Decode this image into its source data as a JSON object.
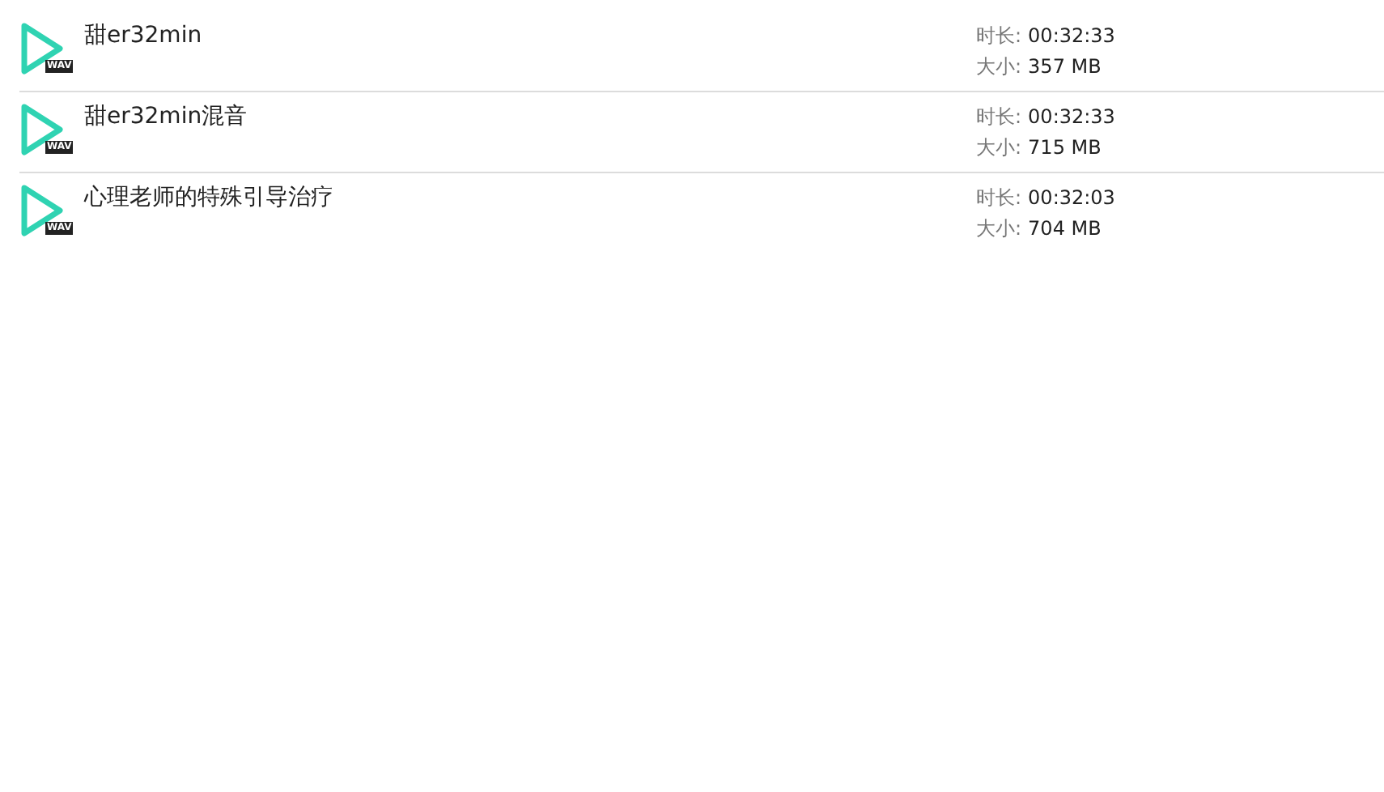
{
  "files": [
    {
      "title": "甜er32min",
      "type": "WAV",
      "duration_label": "时长:",
      "duration": "00:32:33",
      "size_label": "大小:",
      "size": "357 MB"
    },
    {
      "title": "甜er32min混音",
      "type": "WAV",
      "duration_label": "时长:",
      "duration": "00:32:33",
      "size_label": "大小:",
      "size": "715 MB"
    },
    {
      "title": "心理老师的特殊引导治疗",
      "type": "WAV",
      "duration_label": "时长:",
      "duration": "00:32:03",
      "size_label": "大小:",
      "size": "704 MB"
    }
  ]
}
